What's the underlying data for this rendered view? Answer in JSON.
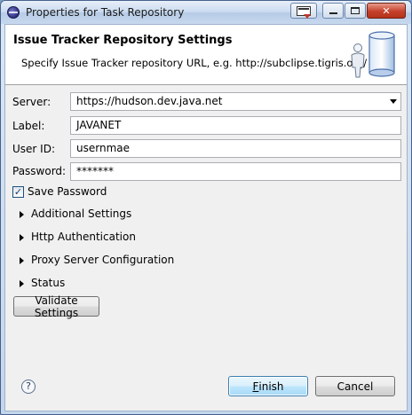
{
  "window": {
    "title": "Properties for Task Repository",
    "icon": "eclipse-icon",
    "controls": [
      "menu-icon",
      "minimize-icon",
      "maximize-icon",
      "close-icon"
    ]
  },
  "banner": {
    "title": "Issue Tracker Repository Settings",
    "description": "Specify Issue Tracker repository URL, e.g. http://subclipse.tigris.org/",
    "icon": "repository-server-icon"
  },
  "form": {
    "server_label": "Server:",
    "server_value": "https://hudson.dev.java.net",
    "label_label": "Label:",
    "label_value": "JAVANET",
    "userid_label": "User ID:",
    "userid_value": "usernmae",
    "password_label": "Password:",
    "password_value": "*******",
    "save_password_label": "Save Password",
    "save_password_checked": true
  },
  "sections": [
    {
      "label": "Additional Settings"
    },
    {
      "label": "Http Authentication"
    },
    {
      "label": "Proxy Server Configuration"
    },
    {
      "label": "Status"
    }
  ],
  "buttons": {
    "validate": "Validate Settings",
    "finish_mnemonic": "F",
    "finish_rest": "inish",
    "cancel": "Cancel",
    "help": "?"
  },
  "colors": {
    "titlebar": "#c9daef",
    "client_bg": "#f0f0f0",
    "close_button": "#c5402a",
    "default_button_border": "#3c7fb1"
  }
}
